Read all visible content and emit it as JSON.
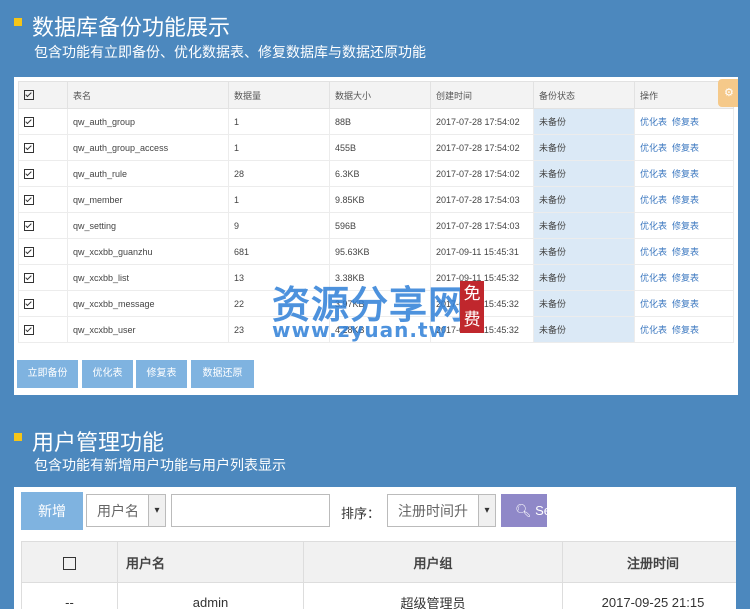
{
  "section1": {
    "title": "数据库备份功能展示",
    "subtitle": "包含功能有立即备份、优化数据表、修复数据库与数据还原功能",
    "table": {
      "headers": [
        "表名",
        "数据量",
        "数据大小",
        "创建时间",
        "备份状态",
        "操作"
      ],
      "rows": [
        {
          "name": "qw_auth_group",
          "count": "1",
          "size": "88B",
          "created": "2017-07-28 17:54:02",
          "status": "未备份",
          "op1": "优化表",
          "op2": "修复表"
        },
        {
          "name": "qw_auth_group_access",
          "count": "1",
          "size": "455B",
          "created": "2017-07-28 17:54:02",
          "status": "未备份",
          "op1": "优化表",
          "op2": "修复表"
        },
        {
          "name": "qw_auth_rule",
          "count": "28",
          "size": "6.3KB",
          "created": "2017-07-28 17:54:02",
          "status": "未备份",
          "op1": "优化表",
          "op2": "修复表"
        },
        {
          "name": "qw_member",
          "count": "1",
          "size": "9.85KB",
          "created": "2017-07-28 17:54:03",
          "status": "未备份",
          "op1": "优化表",
          "op2": "修复表"
        },
        {
          "name": "qw_setting",
          "count": "9",
          "size": "596B",
          "created": "2017-07-28 17:54:03",
          "status": "未备份",
          "op1": "优化表",
          "op2": "修复表"
        },
        {
          "name": "qw_xcxbb_guanzhu",
          "count": "681",
          "size": "95.63KB",
          "created": "2017-09-11 15:45:31",
          "status": "未备份",
          "op1": "优化表",
          "op2": "修复表"
        },
        {
          "name": "qw_xcxbb_list",
          "count": "13",
          "size": "3.38KB",
          "created": "2017-09-11 15:45:32",
          "status": "未备份",
          "op1": "优化表",
          "op2": "修复表"
        },
        {
          "name": "qw_xcxbb_message",
          "count": "22",
          "size": "3.97KB",
          "created": "2017-09-11 15:45:32",
          "status": "未备份",
          "op1": "优化表",
          "op2": "修复表"
        },
        {
          "name": "qw_xcxbb_user",
          "count": "23",
          "size": "4.28KB",
          "created": "2017-09-11 15:45:32",
          "status": "未备份",
          "op1": "优化表",
          "op2": "修复表"
        }
      ]
    },
    "buttons": {
      "backup": "立即备份",
      "optimize": "优化表",
      "repair": "修复表",
      "restore": "数据还原"
    },
    "gear_icon": "gear-icon"
  },
  "section2": {
    "title": "用户管理功能",
    "subtitle": "包含功能有新增用户功能与用户列表显示",
    "add_label": "新增",
    "field_select": "用户名",
    "sort_label": "排序：",
    "sort_select": "注册时间升",
    "search_label": "Se",
    "table": {
      "headers": [
        "用户名",
        "用户组",
        "注册时间"
      ],
      "rows": [
        {
          "check": "--",
          "username": "admin",
          "group": "超级管理员",
          "time": "2017-09-25 21:15"
        }
      ]
    }
  },
  "watermark": {
    "text": "资源分享网",
    "url": "www.zyuan.tw",
    "stamp": "免费"
  },
  "colors": {
    "background": "#4c88be",
    "accent": "#f5c518",
    "button": "#7fb3e0",
    "link": "#3c78c0"
  }
}
